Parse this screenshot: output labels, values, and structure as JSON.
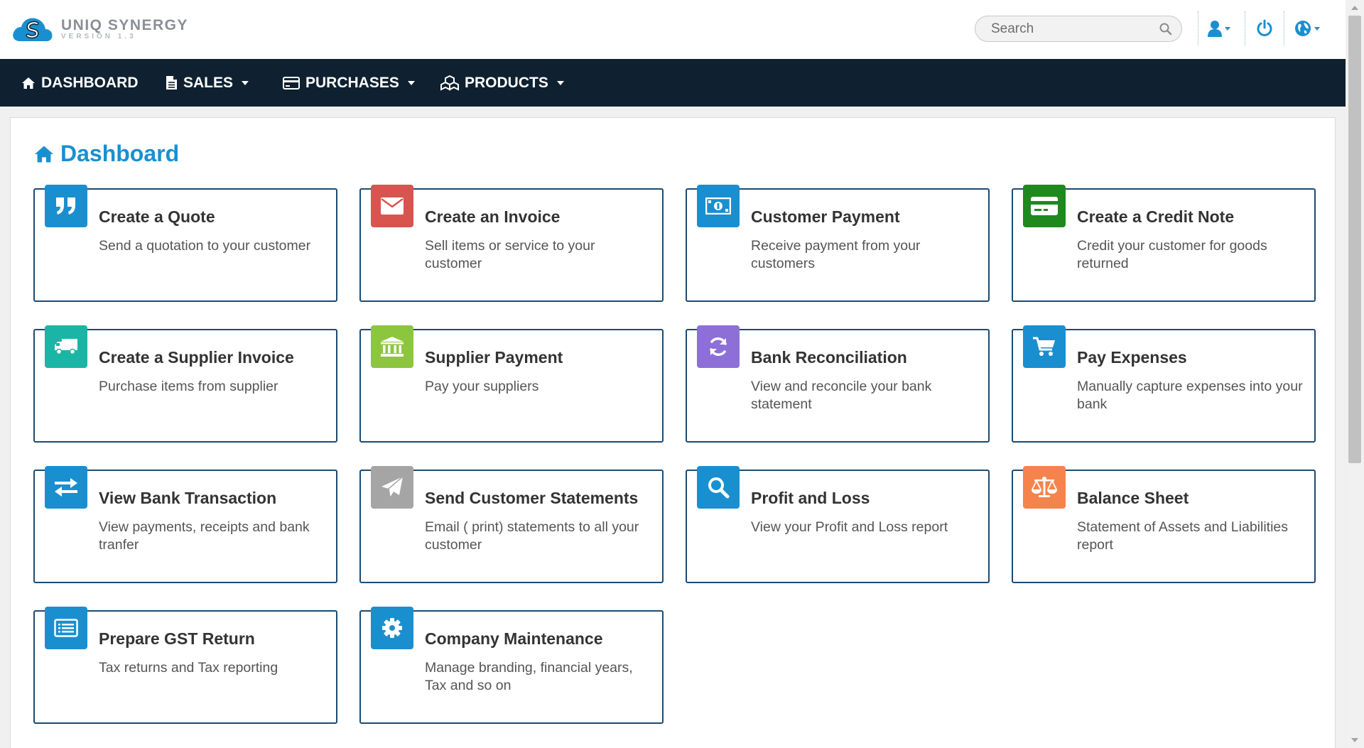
{
  "brand": {
    "name": "UNIQ SYNERGY",
    "version": "VERSION 1.3"
  },
  "header": {
    "search_placeholder": "Search"
  },
  "nav": [
    {
      "label": "DASHBOARD",
      "icon": "home-icon"
    },
    {
      "label": "SALES",
      "icon": "document-icon"
    },
    {
      "label": "PURCHASES",
      "icon": "credit-card-icon"
    },
    {
      "label": "PRODUCTS",
      "icon": "cubes-icon"
    }
  ],
  "page": {
    "title": "Dashboard"
  },
  "cards": [
    {
      "title": "Create a Quote",
      "desc": "Send a quotation to your customer",
      "icon": "quote-icon",
      "color": "#1a8fd0"
    },
    {
      "title": "Create an Invoice",
      "desc": "Sell items or service to your customer",
      "icon": "envelope-icon",
      "color": "#d9534f"
    },
    {
      "title": "Customer Payment",
      "desc": "Receive payment from your customers",
      "icon": "money-icon",
      "color": "#1a8fd0"
    },
    {
      "title": "Create a Credit Note",
      "desc": "Credit your customer for goods returned",
      "icon": "credit-card-icon",
      "color": "#1e8a1e"
    },
    {
      "title": "Create a Supplier Invoice",
      "desc": "Purchase items from supplier",
      "icon": "truck-icon",
      "color": "#1bb5a5"
    },
    {
      "title": "Supplier Payment",
      "desc": "Pay your suppliers",
      "icon": "bank-icon",
      "color": "#8cc63f"
    },
    {
      "title": "Bank Reconciliation",
      "desc": "View and reconcile your bank statement",
      "icon": "refresh-icon",
      "color": "#8e6fd8"
    },
    {
      "title": "Pay Expenses",
      "desc": "Manually capture expenses into your bank",
      "icon": "cart-icon",
      "color": "#1a8fd0"
    },
    {
      "title": "View Bank Transaction",
      "desc": "View payments, receipts and bank tranfer",
      "icon": "exchange-icon",
      "color": "#1a8fd0"
    },
    {
      "title": "Send Customer Statements",
      "desc": "Email ( print) statements to all your customer",
      "icon": "paper-plane-icon",
      "color": "#a5a5a5"
    },
    {
      "title": "Profit and Loss",
      "desc": "View your Profit and Loss report",
      "icon": "search-icon",
      "color": "#1a8fd0"
    },
    {
      "title": "Balance Sheet",
      "desc": "Statement of Assets and Liabilities report",
      "icon": "balance-scale-icon",
      "color": "#f5844c"
    },
    {
      "title": "Prepare GST Return",
      "desc": "Tax returns and Tax reporting",
      "icon": "list-alt-icon",
      "color": "#1a8fd0"
    },
    {
      "title": "Company Maintenance",
      "desc": "Manage branding, financial years, Tax and so on",
      "icon": "gear-icon",
      "color": "#1a8fd0"
    }
  ]
}
